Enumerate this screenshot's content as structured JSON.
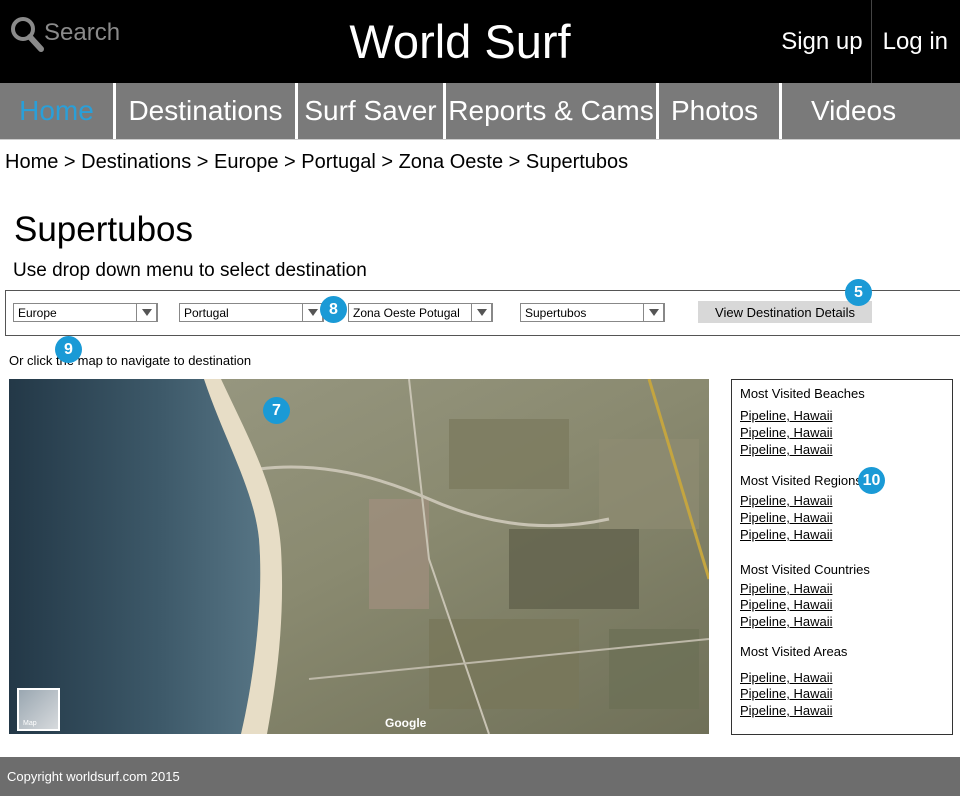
{
  "header": {
    "search_label": "Search",
    "site_title": "World Surf",
    "signup_label": "Sign up",
    "login_label": "Log in"
  },
  "nav": {
    "tabs": [
      {
        "label": "Home",
        "active": true
      },
      {
        "label": "Destinations"
      },
      {
        "label": "Surf Saver"
      },
      {
        "label": "Reports & Cams"
      },
      {
        "label": "Photos"
      },
      {
        "label": "Videos"
      }
    ],
    "active_color": "#2a9fd8",
    "tab_color": "#7a7a7a"
  },
  "breadcrumb": "Home > Destinations > Europe > Portugal > Zona Oeste > Supertubos",
  "page": {
    "title": "Supertubos",
    "instructions": "Use drop down menu to select destination",
    "map_hint": "Or click the map to navigate to destination"
  },
  "selectors": {
    "continent": "Europe",
    "country": "Portugal",
    "region": "Zona Oeste Potugal",
    "beach": "Supertubos",
    "view_button": "View Destination Details"
  },
  "badges": {
    "b5": "5",
    "b7": "7",
    "b8": "8",
    "b9": "9",
    "b10": "10"
  },
  "map": {
    "google_label": "Google",
    "thumb_label": "Map"
  },
  "sidebar": {
    "sections": [
      {
        "heading": "Most Visited Beaches",
        "links": [
          "Pipeline, Hawaii",
          "Pipeline, Hawaii",
          "Pipeline, Hawaii"
        ]
      },
      {
        "heading": "Most Visited Regions",
        "links": [
          "Pipeline, Hawaii",
          "Pipeline, Hawaii",
          "Pipeline, Hawaii"
        ]
      },
      {
        "heading": "Most Visited Countries",
        "links": [
          "Pipeline, Hawaii",
          "Pipeline, Hawaii",
          "Pipeline, Hawaii"
        ]
      },
      {
        "heading": "Most Visited Areas",
        "links": [
          "Pipeline, Hawaii",
          "Pipeline, Hawaii",
          "Pipeline, Hawaii"
        ]
      }
    ]
  },
  "footer": {
    "copyright": "Copyright worldsurf.com 2015"
  }
}
